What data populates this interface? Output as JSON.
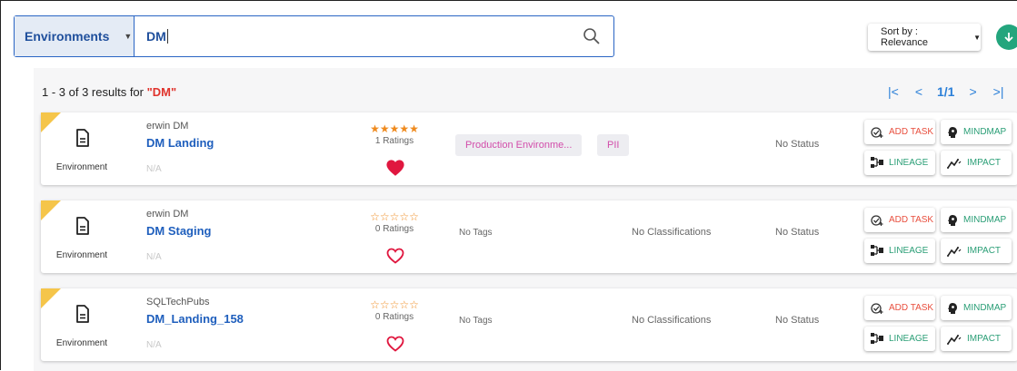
{
  "search": {
    "scope": "Environments",
    "query": "DM"
  },
  "sort": {
    "label": "Sort by : Relevance"
  },
  "results": {
    "summary_prefix": "1 - 3 of 3 results for ",
    "summary_query": "\"DM\""
  },
  "pagination": {
    "first": "|<",
    "prev": "<",
    "page": "1/1",
    "next": ">",
    "last": ">|"
  },
  "cards": [
    {
      "type": "Environment",
      "source": "erwin DM",
      "name": "DM Landing",
      "description": "N/A",
      "stars": "★★★★★",
      "ratings": "1 Ratings",
      "favorite": true,
      "tag": "Production Environme...",
      "classification": "PII",
      "status": "No Status"
    },
    {
      "type": "Environment",
      "source": "erwin DM",
      "name": "DM Staging",
      "description": "N/A",
      "stars": "☆☆☆☆☆",
      "ratings": "0 Ratings",
      "favorite": false,
      "tag": "No Tags",
      "classification": "No Classifications",
      "status": "No Status"
    },
    {
      "type": "Environment",
      "source": "SQLTechPubs",
      "name": "DM_Landing_158",
      "description": "N/A",
      "stars": "☆☆☆☆☆",
      "ratings": "0 Ratings",
      "favorite": false,
      "tag": "No Tags",
      "classification": "No Classifications",
      "status": "No Status"
    }
  ],
  "actions": {
    "add_task": "ADD TASK",
    "mindmap": "MINDMAP",
    "lineage": "LINEAGE",
    "impact": "IMPACT"
  },
  "colors": {
    "accent_blue": "#1f5fbd",
    "star": "#ef8a1e",
    "heart": "#e0173f",
    "add_task": "#e84e3d",
    "action_green": "#2a9e76",
    "flag": "#f5c54a",
    "download": "#23a57d"
  },
  "icons": [
    "search-icon",
    "chevron-down-icon",
    "download-icon",
    "document-icon",
    "heart-icon",
    "add-task-icon",
    "mindmap-icon",
    "lineage-icon",
    "impact-icon"
  ]
}
